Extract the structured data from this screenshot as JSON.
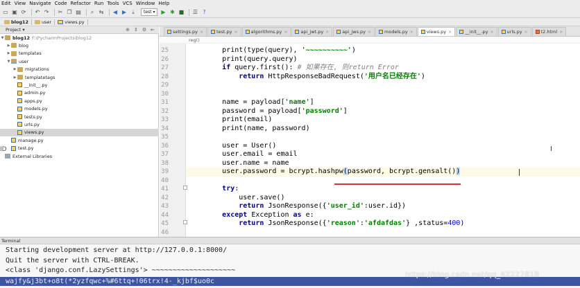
{
  "menubar": [
    "Edit",
    "View",
    "Navigate",
    "Code",
    "Refactor",
    "Run",
    "Tools",
    "VCS",
    "Window",
    "Help"
  ],
  "toolbar": {
    "run_config": "test",
    "icons": [
      "folder-open-icon",
      "save-icon",
      "sync-icon",
      "undo-icon",
      "redo-icon",
      "cut-icon",
      "copy-icon",
      "paste-icon",
      "find-icon",
      "replace-icon",
      "back-icon",
      "forward-icon",
      "build-icon",
      "run-icon",
      "debug-icon",
      "stop-icon",
      "tasks-icon",
      "help-icon"
    ]
  },
  "navbar": [
    "blog12",
    "user",
    "views.py"
  ],
  "project_panel": {
    "title": "Project",
    "root_name": "blog12",
    "root_path": "F:\\PycharmProjects\\blog12",
    "items": [
      {
        "label": "blog",
        "type": "folder",
        "depth": 1,
        "expanded": false
      },
      {
        "label": "templates",
        "type": "folder",
        "depth": 1,
        "expanded": false
      },
      {
        "label": "user",
        "type": "pkg",
        "depth": 1,
        "expanded": true
      },
      {
        "label": "migrations",
        "type": "folder",
        "depth": 2,
        "expanded": false
      },
      {
        "label": "templatetags",
        "type": "folder",
        "depth": 2,
        "expanded": false
      },
      {
        "label": "__init__.py",
        "type": "py",
        "depth": 2
      },
      {
        "label": "admin.py",
        "type": "py",
        "depth": 2
      },
      {
        "label": "apps.py",
        "type": "py",
        "depth": 2
      },
      {
        "label": "models.py",
        "type": "py",
        "depth": 2
      },
      {
        "label": "tests.py",
        "type": "py",
        "depth": 2
      },
      {
        "label": "urls.py",
        "type": "py",
        "depth": 2
      },
      {
        "label": "views.py",
        "type": "py",
        "depth": 2,
        "selected": true
      },
      {
        "label": "manage.py",
        "type": "py",
        "depth": 1
      },
      {
        "label": "test.py",
        "type": "py",
        "depth": 1
      },
      {
        "label": "External Libraries",
        "type": "lib",
        "depth": 0
      }
    ]
  },
  "tabs": [
    {
      "label": "settings.py",
      "active": false
    },
    {
      "label": "test.py",
      "active": false
    },
    {
      "label": "algorithms.py",
      "active": false
    },
    {
      "label": "api_jwt.py",
      "active": false
    },
    {
      "label": "api_jws.py",
      "active": false
    },
    {
      "label": "models.py",
      "active": false
    },
    {
      "label": "views.py",
      "active": true
    },
    {
      "label": "__init__.py",
      "active": false
    },
    {
      "label": "urls.py",
      "active": false
    },
    {
      "label": "t2.html",
      "active": false
    }
  ],
  "editor_breadcrumb": "reg()",
  "code_lines": [
    {
      "no": "25",
      "html": "        print(type(query), <span class=\"st\">'~~~~~~~~~~'</span>)"
    },
    {
      "no": "26",
      "html": "        print(query.query)"
    },
    {
      "no": "27",
      "html": "        <span class=\"kw\">if</span> query.first(): <span class=\"cm\"># 如果存在, 则return Error</span>"
    },
    {
      "no": "28",
      "html": "            <span class=\"kw\">return</span> HttpResponseBadRequest(<span class=\"st\">'用户名已经存在'</span>)"
    },
    {
      "no": "29",
      "html": ""
    },
    {
      "no": "30",
      "html": ""
    },
    {
      "no": "31",
      "html": "        name = payload[<span class=\"st\">'name'</span>]"
    },
    {
      "no": "32",
      "html": "        password = payload[<span class=\"st\">'password'</span>]"
    },
    {
      "no": "33",
      "html": "        print(email)"
    },
    {
      "no": "34",
      "html": "        print(name, password)"
    },
    {
      "no": "35",
      "html": ""
    },
    {
      "no": "36",
      "html": "        user = User()"
    },
    {
      "no": "37",
      "html": "        user.email = email"
    },
    {
      "no": "38",
      "html": "        user.name = name"
    },
    {
      "no": "39",
      "html": "        user.password = bcrypt.hashpw<span class=\"hl\">(</span>password, bcrypt.gensalt()<span class=\"hl\">)</span>",
      "current": true
    },
    {
      "no": "40",
      "html": ""
    },
    {
      "no": "41",
      "html": "        <span class=\"kw\">try</span>:"
    },
    {
      "no": "42",
      "html": "            user.save()"
    },
    {
      "no": "43",
      "html": "            <span class=\"kw\">return</span> JsonResponse({<span class=\"st\">'user_id'</span>:user.id})"
    },
    {
      "no": "44",
      "html": "        <span class=\"kw\">except</span> Exception <span class=\"kw\">as</span> e:"
    },
    {
      "no": "45",
      "html": "            <span class=\"kw\">return</span> JsonResponse({<span class=\"st\">'reason'</span>:<span class=\"st\">'afdafdas'</span>} ,status=<span class=\"num\">400</span>)"
    },
    {
      "no": "46",
      "html": ""
    }
  ],
  "terminal": {
    "title": "Terminal",
    "lines": [
      "Starting development server at http://127.0.0.1:8000/",
      "Quit the server with CTRL-BREAK.",
      "<class 'django.conf.LazySettings'> ~~~~~~~~~~~~~~~~~~~~"
    ],
    "selected_line": "wajfy&j3bt+o8t(*2yzfqwc+%#6ttq+!06trx!4-_kjbf$uo0c",
    "watermark": "https://blog.csdn.net/qq_42227818"
  },
  "side_fragment": "ID"
}
